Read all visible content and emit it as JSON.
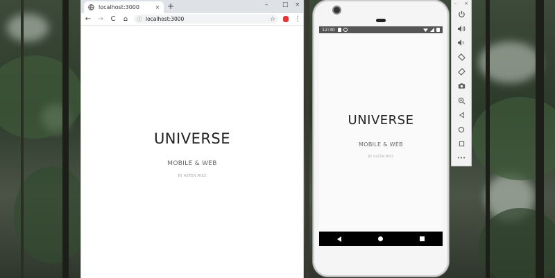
{
  "browser": {
    "tab_title": "localhost:3000",
    "new_tab": "+",
    "tab_close": "×",
    "window_controls": {
      "minimize": "–",
      "maximize": "□",
      "close": "×"
    },
    "nav": {
      "back": "←",
      "forward": "→",
      "reload": "C",
      "home": "⌂"
    },
    "address": "localhost:3000",
    "star": "☆",
    "menu": "⋮"
  },
  "web_page": {
    "title": "UNIVERSE",
    "subtitle": "MOBILE & WEB",
    "byline": "BY ASTEN MIES"
  },
  "phone": {
    "status_time": "12:30",
    "app": {
      "title": "UNIVERSE",
      "subtitle": "MOBILE & WEB",
      "byline": "BY ASTEN MIES"
    }
  },
  "emulator_toolbar": {
    "close": "×",
    "minimize": "–",
    "more": "•••"
  }
}
